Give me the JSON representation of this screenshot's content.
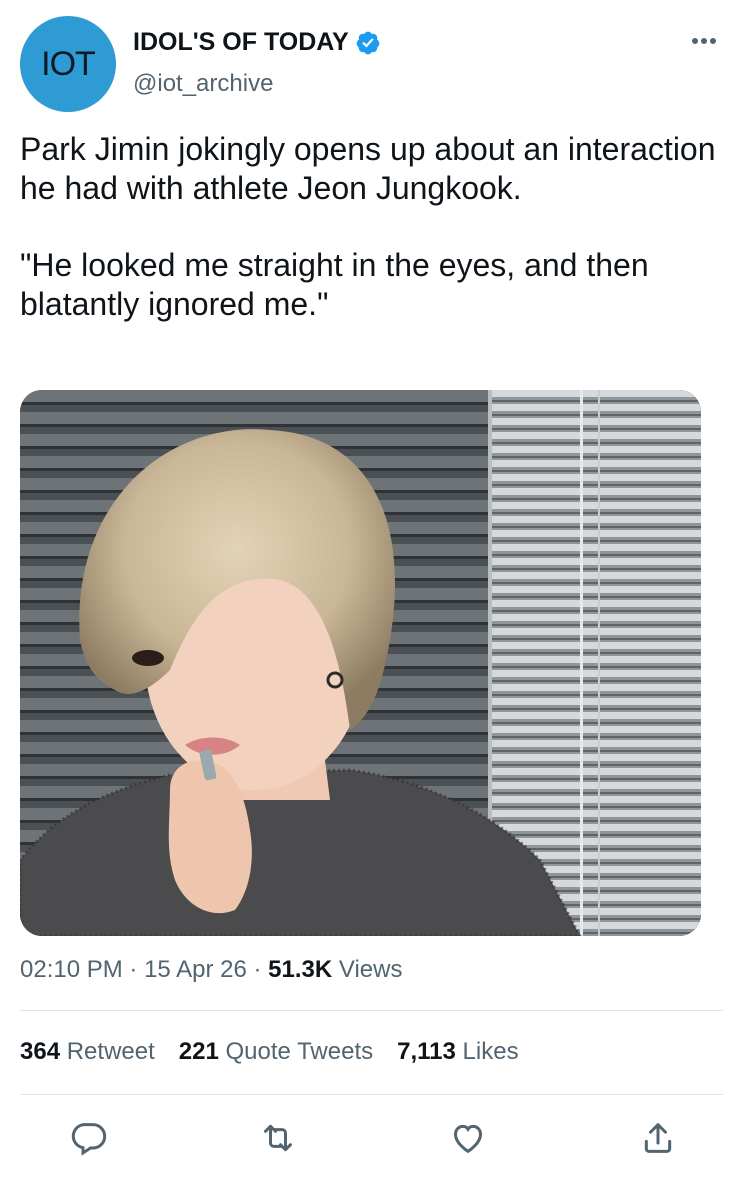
{
  "author": {
    "avatar_text": "IOT",
    "display_name": "IDOL'S OF TODAY",
    "handle": "@iot_archive",
    "verified": true,
    "avatar_color": "#2f9bd4"
  },
  "tweet": {
    "text_line1": "Park Jimin jokingly opens up about an interaction he had with athlete Jeon Jungkook.",
    "text_line2": "\"He looked me straight in the eyes, and then blatantly ignored me.\""
  },
  "meta": {
    "time": "02:10 PM",
    "date": "15 Apr 26",
    "views_count": "51.3K",
    "views_label": "Views"
  },
  "stats": {
    "retweets_count": "364",
    "retweets_label": "Retweet",
    "quotes_count": "221",
    "quotes_label": "Quote Tweets",
    "likes_count": "7,113",
    "likes_label": "Likes"
  },
  "icons": {
    "more": "more-dots-icon",
    "verified": "verified-badge-icon",
    "reply": "reply-icon",
    "retweet": "retweet-icon",
    "like": "like-icon",
    "share": "share-icon"
  },
  "colors": {
    "accent": "#1d9bf0",
    "secondary_text": "#536471",
    "primary_text": "#0f1419"
  }
}
